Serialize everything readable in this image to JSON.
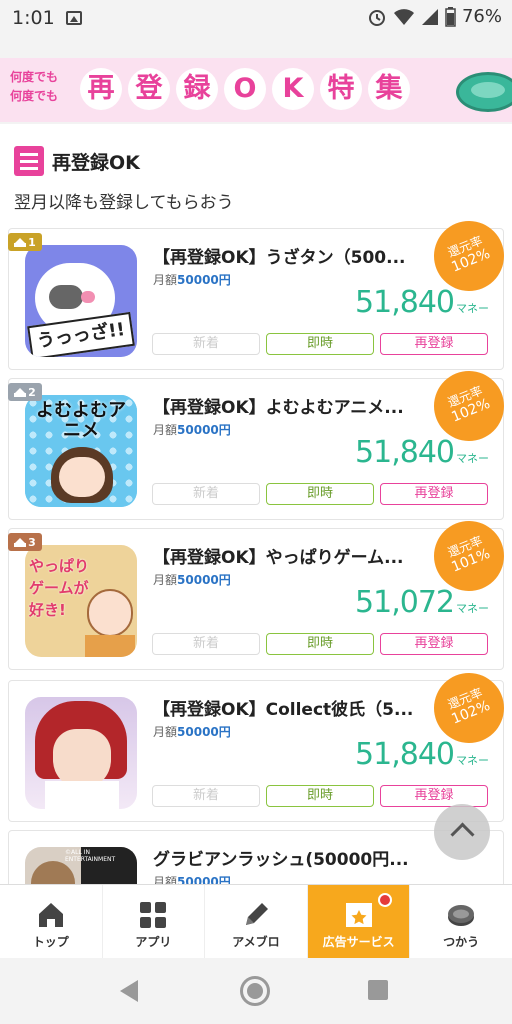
{
  "status_bar": {
    "time": "1:01",
    "battery": "76%"
  },
  "banner": {
    "small_line1": "何度でも",
    "small_line2": "何度でも",
    "chars": [
      "再",
      "登",
      "録",
      "O",
      "K",
      "特",
      "集"
    ]
  },
  "section": {
    "title": "再登録OK",
    "subtitle": "翌月以降も登録してもらおう"
  },
  "labels": {
    "monthly_prefix": "月額",
    "unit": "マネー",
    "rate_prefix": "還元率",
    "tag_new": "新着",
    "tag_instant": "即時",
    "tag_rereg": "再登録"
  },
  "items": [
    {
      "rank": "1",
      "title": "【再登録OK】うざタン（500...",
      "monthly": "50000円",
      "price": "51,840",
      "rate": "102%",
      "thumb_text": "うっっざ!!"
    },
    {
      "rank": "2",
      "title": "【再登録OK】よむよむアニメ...",
      "monthly": "50000円",
      "price": "51,840",
      "rate": "102%",
      "thumb_text": "よむよむアニメ"
    },
    {
      "rank": "3",
      "title": "【再登録OK】やっぱりゲーム...",
      "monthly": "50000円",
      "price": "51,072",
      "rate": "101%",
      "thumb_text": "やっぱりゲームが好き!"
    },
    {
      "rank": "",
      "title": "【再登録OK】Collect彼氏（5...",
      "monthly": "50000円",
      "price": "51,840",
      "rate": "102%",
      "thumb_text": ""
    },
    {
      "rank": "",
      "title": "グラビアンラッシュ(50000円...",
      "monthly": "50000円",
      "price": "",
      "rate": "",
      "thumb_text": "©ALL IN ENTERTAINMENT"
    }
  ],
  "tabs": [
    {
      "label": "トップ",
      "icon": "home-icon"
    },
    {
      "label": "アプリ",
      "icon": "apps-icon"
    },
    {
      "label": "アメブロ",
      "icon": "pencil-icon"
    },
    {
      "label": "広告サービス",
      "icon": "star-box-icon",
      "active": true
    },
    {
      "label": "つかう",
      "icon": "coin-icon"
    }
  ],
  "colors": {
    "accent_pink": "#e8429b",
    "price_green": "#2bb68f",
    "rate_orange": "#f79b22",
    "active_tab": "#f7a81d"
  }
}
